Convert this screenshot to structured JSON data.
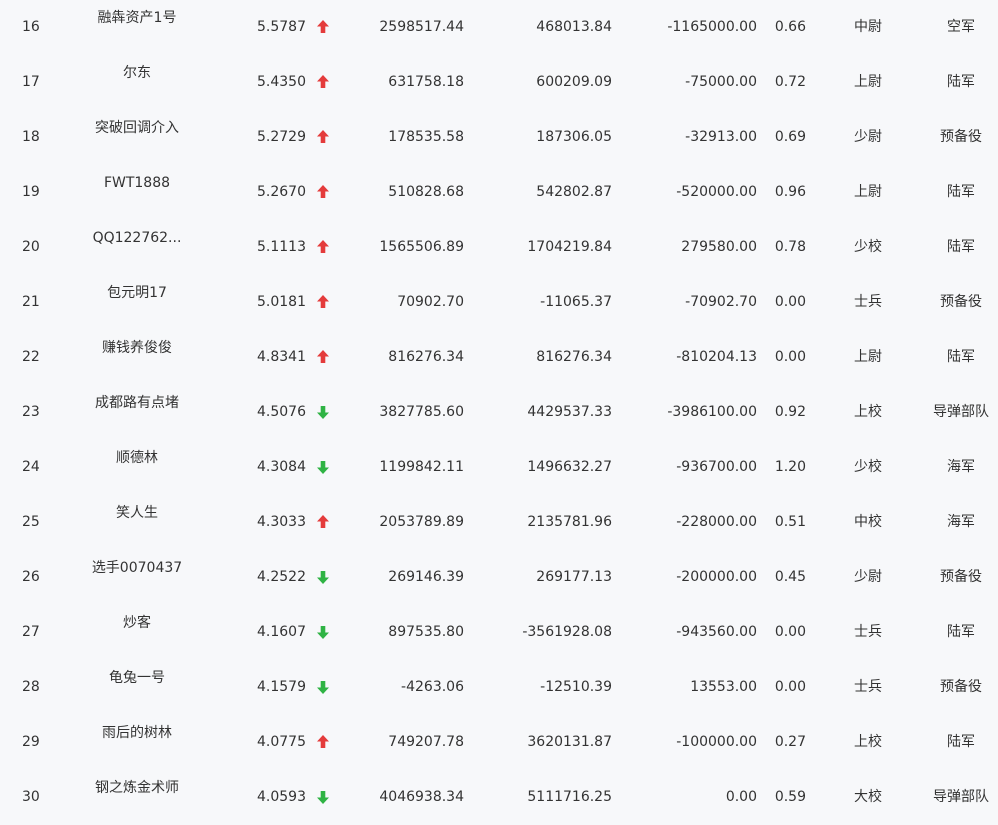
{
  "colors": {
    "up": "#e43b3b",
    "down": "#2fb344",
    "text": "#333333",
    "background": "#f7f8fa"
  },
  "rows": [
    {
      "rank": "16",
      "name": "融犇资产1号",
      "score": "5.5787",
      "trend": "up",
      "v1": "2598517.44",
      "v2": "468013.84",
      "v3": "-1165000.00",
      "ratio": "0.66",
      "military_rank": "中尉",
      "branch": "空军"
    },
    {
      "rank": "17",
      "name": "尔东",
      "score": "5.4350",
      "trend": "up",
      "v1": "631758.18",
      "v2": "600209.09",
      "v3": "-75000.00",
      "ratio": "0.72",
      "military_rank": "上尉",
      "branch": "陆军"
    },
    {
      "rank": "18",
      "name": "突破回调介入",
      "score": "5.2729",
      "trend": "up",
      "v1": "178535.58",
      "v2": "187306.05",
      "v3": "-32913.00",
      "ratio": "0.69",
      "military_rank": "少尉",
      "branch": "预备役"
    },
    {
      "rank": "19",
      "name": "FWT1888",
      "score": "5.2670",
      "trend": "up",
      "v1": "510828.68",
      "v2": "542802.87",
      "v3": "-520000.00",
      "ratio": "0.96",
      "military_rank": "上尉",
      "branch": "陆军"
    },
    {
      "rank": "20",
      "name": "QQ122762...",
      "score": "5.1113",
      "trend": "up",
      "v1": "1565506.89",
      "v2": "1704219.84",
      "v3": "279580.00",
      "ratio": "0.78",
      "military_rank": "少校",
      "branch": "陆军"
    },
    {
      "rank": "21",
      "name": "包元明17",
      "score": "5.0181",
      "trend": "up",
      "v1": "70902.70",
      "v2": "-11065.37",
      "v3": "-70902.70",
      "ratio": "0.00",
      "military_rank": "士兵",
      "branch": "预备役"
    },
    {
      "rank": "22",
      "name": "赚钱养俊俊",
      "score": "4.8341",
      "trend": "up",
      "v1": "816276.34",
      "v2": "816276.34",
      "v3": "-810204.13",
      "ratio": "0.00",
      "military_rank": "上尉",
      "branch": "陆军"
    },
    {
      "rank": "23",
      "name": "成都路有点堵",
      "score": "4.5076",
      "trend": "down",
      "v1": "3827785.60",
      "v2": "4429537.33",
      "v3": "-3986100.00",
      "ratio": "0.92",
      "military_rank": "上校",
      "branch": "导弹部队"
    },
    {
      "rank": "24",
      "name": "顺德林",
      "score": "4.3084",
      "trend": "down",
      "v1": "1199842.11",
      "v2": "1496632.27",
      "v3": "-936700.00",
      "ratio": "1.20",
      "military_rank": "少校",
      "branch": "海军"
    },
    {
      "rank": "25",
      "name": "笑人生",
      "score": "4.3033",
      "trend": "up",
      "v1": "2053789.89",
      "v2": "2135781.96",
      "v3": "-228000.00",
      "ratio": "0.51",
      "military_rank": "中校",
      "branch": "海军"
    },
    {
      "rank": "26",
      "name": "选手0070437",
      "score": "4.2522",
      "trend": "down",
      "v1": "269146.39",
      "v2": "269177.13",
      "v3": "-200000.00",
      "ratio": "0.45",
      "military_rank": "少尉",
      "branch": "预备役"
    },
    {
      "rank": "27",
      "name": "炒客",
      "score": "4.1607",
      "trend": "down",
      "v1": "897535.80",
      "v2": "-3561928.08",
      "v3": "-943560.00",
      "ratio": "0.00",
      "military_rank": "士兵",
      "branch": "陆军"
    },
    {
      "rank": "28",
      "name": "龟兔一号",
      "score": "4.1579",
      "trend": "down",
      "v1": "-4263.06",
      "v2": "-12510.39",
      "v3": "13553.00",
      "ratio": "0.00",
      "military_rank": "士兵",
      "branch": "预备役"
    },
    {
      "rank": "29",
      "name": "雨后的树林",
      "score": "4.0775",
      "trend": "up",
      "v1": "749207.78",
      "v2": "3620131.87",
      "v3": "-100000.00",
      "ratio": "0.27",
      "military_rank": "上校",
      "branch": "陆军"
    },
    {
      "rank": "30",
      "name": "钢之炼金术师",
      "score": "4.0593",
      "trend": "down",
      "v1": "4046938.34",
      "v2": "5111716.25",
      "v3": "0.00",
      "ratio": "0.59",
      "military_rank": "大校",
      "branch": "导弹部队"
    }
  ]
}
